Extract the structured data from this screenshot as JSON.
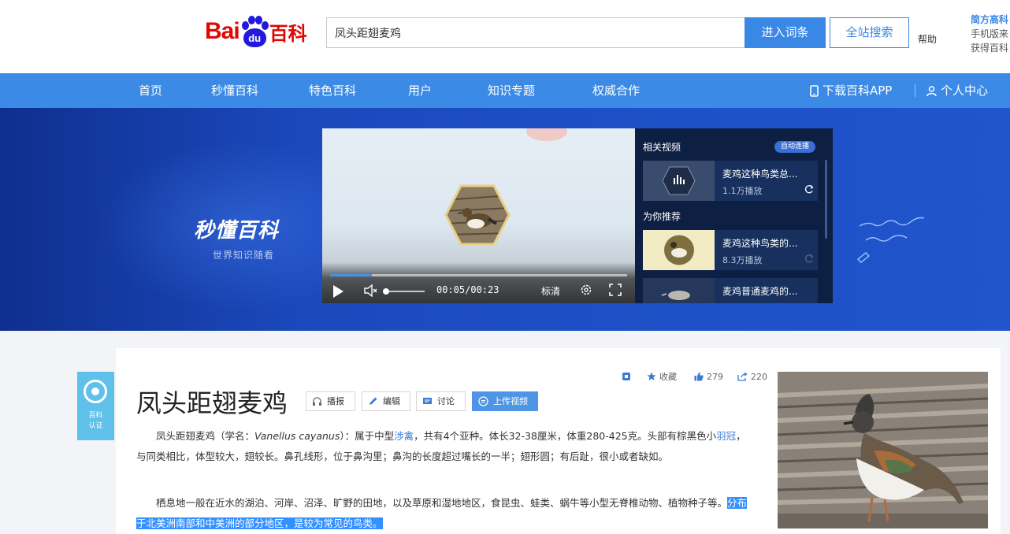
{
  "brand": {
    "logo_left": "Bai",
    "logo_paw": "du",
    "logo_right": "百科"
  },
  "search": {
    "value": "凤头距翅麦鸡",
    "enter_label": "进入词条",
    "all_label": "全站搜索",
    "help_label": "帮助"
  },
  "promo": {
    "title": "简方高科",
    "line1": "手机版来",
    "line2": "获得百科"
  },
  "nav": {
    "items": [
      "首页",
      "秒懂百科",
      "特色百科",
      "用户",
      "知识专题",
      "权威合作"
    ],
    "download_app": "下载百科APP",
    "user_center": "个人中心"
  },
  "banner": {
    "title": "秒懂百科",
    "subtitle": "世界知识随看"
  },
  "player": {
    "time": "00:05/00:23",
    "hd": "标清",
    "progress_fraction": 0.14
  },
  "side": {
    "heading": "相关视频",
    "pill": "自动连播",
    "section": "为你推荐",
    "cards": [
      {
        "title": "麦鸡这种鸟类总...",
        "plays": "1.1万播放"
      },
      {
        "title": "麦鸡这种鸟类的...",
        "plays": "8.3万播放"
      },
      {
        "title": "麦鸡普通麦鸡的...",
        "plays": ""
      }
    ]
  },
  "badge": {
    "line1": "百科",
    "line2": "认证"
  },
  "entry": {
    "title": "凤头距翅麦鸡",
    "tools": {
      "voice": "播报",
      "edit": "编辑",
      "discuss": "讨论",
      "upload": "上传视频"
    },
    "stats": {
      "collect": "收藏",
      "likes": "279",
      "shares": "220"
    }
  },
  "paragraphs": {
    "p1_a": "凤头距翅麦鸡（学名：",
    "p1_latin": "Vanellus cayanus",
    "p1_b": "）：属于中型",
    "p1_link1": "涉禽",
    "p1_c": "，共有4个亚种。体长32-38厘米，体重280-425克。头部有棕黑色小",
    "p1_link2": "羽冠",
    "p1_d": "，与同类相比，体型较大，翅较长。鼻孔线形，位于鼻沟里；鼻沟的长度超过嘴长的一半；翅形圆；有后趾，很小或者缺如。",
    "p2_a": "栖息地一般在近水的湖泊、河岸、沼泽、旷野的田地，以及草原和湿地地区，食昆虫、蛙类、蜗牛等小型无脊椎动物、植物种子等。",
    "p2_hl": "分布于北美洲南部和中美洲的部分地区，是较为常见的鸟类。"
  },
  "colors": {
    "nav_blue": "#3b8be6",
    "brand_red": "#e10601",
    "brand_blue": "#2319dc",
    "banner_blue": "#1e4fc6"
  }
}
